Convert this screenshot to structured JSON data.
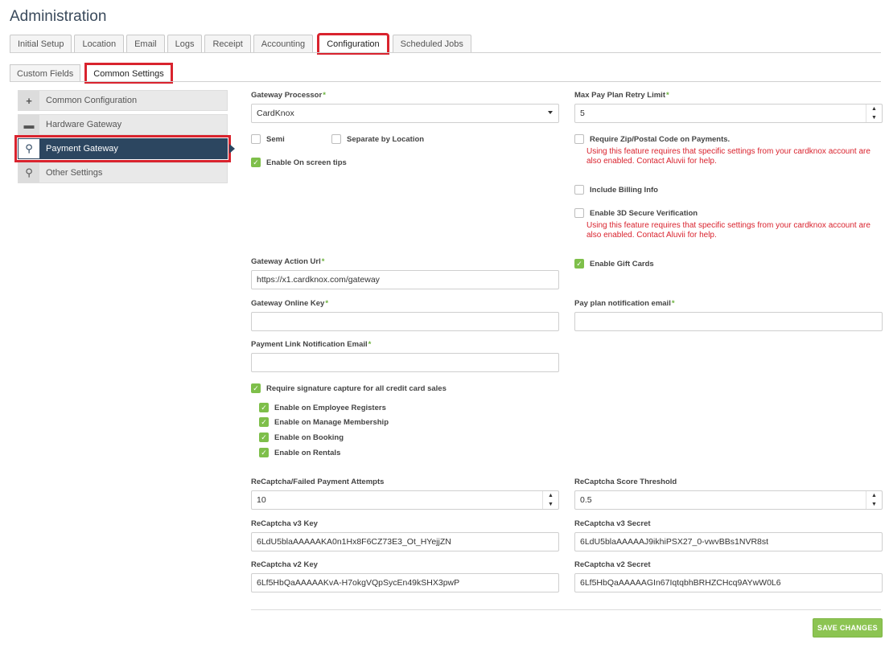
{
  "page": {
    "title": "Administration"
  },
  "tabs": [
    {
      "label": "Initial Setup"
    },
    {
      "label": "Location"
    },
    {
      "label": "Email"
    },
    {
      "label": "Logs"
    },
    {
      "label": "Receipt"
    },
    {
      "label": "Accounting"
    },
    {
      "label": "Configuration",
      "active": true
    },
    {
      "label": "Scheduled Jobs"
    }
  ],
  "subtabs": [
    {
      "label": "Custom Fields"
    },
    {
      "label": "Common Settings",
      "active": true
    }
  ],
  "menu": [
    {
      "label": "Common Configuration",
      "icon": "plus-icon",
      "glyph": "+"
    },
    {
      "label": "Hardware Gateway",
      "icon": "card-icon",
      "glyph": "▬"
    },
    {
      "label": "Payment Gateway",
      "icon": "search-icon",
      "glyph": "⚲",
      "active": true
    },
    {
      "label": "Other Settings",
      "icon": "search-icon",
      "glyph": "⚲"
    }
  ],
  "form": {
    "gateway_processor": {
      "label": "Gateway Processor",
      "value": "CardKnox"
    },
    "max_retry": {
      "label": "Max Pay Plan Retry Limit",
      "value": "5"
    },
    "semi": {
      "label": "Semi",
      "checked": false
    },
    "separate_location": {
      "label": "Separate by Location",
      "checked": false
    },
    "onscreen_tips": {
      "label": "Enable On screen tips",
      "checked": true
    },
    "require_zip": {
      "label": "Require Zip/Postal Code on Payments.",
      "checked": false
    },
    "warn1": "Using this feature requires that specific settings from your cardknox account are also enabled. Contact Aluvii for help.",
    "billing_info": {
      "label": "Include Billing Info",
      "checked": false
    },
    "secure3d": {
      "label": "Enable 3D Secure Verification",
      "checked": false
    },
    "warn2": "Using this feature requires that specific settings from your cardknox account are also enabled. Contact Aluvii for help.",
    "gateway_action_url": {
      "label": "Gateway Action Url",
      "value": "https://x1.cardknox.com/gateway"
    },
    "gift_cards": {
      "label": "Enable Gift Cards",
      "checked": true
    },
    "gateway_online_key": {
      "label": "Gateway Online Key",
      "value": ""
    },
    "pay_plan_email": {
      "label": "Pay plan notification email",
      "value": ""
    },
    "payment_link_email": {
      "label": "Payment Link Notification Email",
      "value": ""
    },
    "require_signature": {
      "label": "Require signature capture for all credit card sales",
      "checked": true
    },
    "sig_employee": {
      "label": "Enable on Employee Registers",
      "checked": true
    },
    "sig_membership": {
      "label": "Enable on Manage Membership",
      "checked": true
    },
    "sig_booking": {
      "label": "Enable on Booking",
      "checked": true
    },
    "sig_rentals": {
      "label": "Enable on Rentals",
      "checked": true
    },
    "recaptcha_attempts": {
      "label": "ReCaptcha/Failed Payment Attempts",
      "value": "10"
    },
    "recaptcha_threshold": {
      "label": "ReCaptcha Score Threshold",
      "value": "0.5"
    },
    "recaptcha_v3_key": {
      "label": "ReCaptcha v3 Key",
      "value": "6LdU5blaAAAAAKA0n1Hx8F6CZ73E3_Ot_HYejjZN"
    },
    "recaptcha_v3_secret": {
      "label": "ReCaptcha v3 Secret",
      "value": "6LdU5blaAAAAAJ9ikhiPSX27_0-vwvBBs1NVR8st"
    },
    "recaptcha_v2_key": {
      "label": "ReCaptcha v2 Key",
      "value": "6Lf5HbQaAAAAAKvA-H7okgVQpSycEn49kSHX3pwP"
    },
    "recaptcha_v2_secret": {
      "label": "ReCaptcha v2 Secret",
      "value": "6Lf5HbQaAAAAAGIn67IqtqbhBRHZCHcq9AYwW0L6"
    }
  },
  "actions": {
    "save_label": "SAVE CHANGES"
  },
  "colors": {
    "accent": "#7ebf4a",
    "highlight": "#d9232e",
    "menu_active": "#2c4660"
  }
}
